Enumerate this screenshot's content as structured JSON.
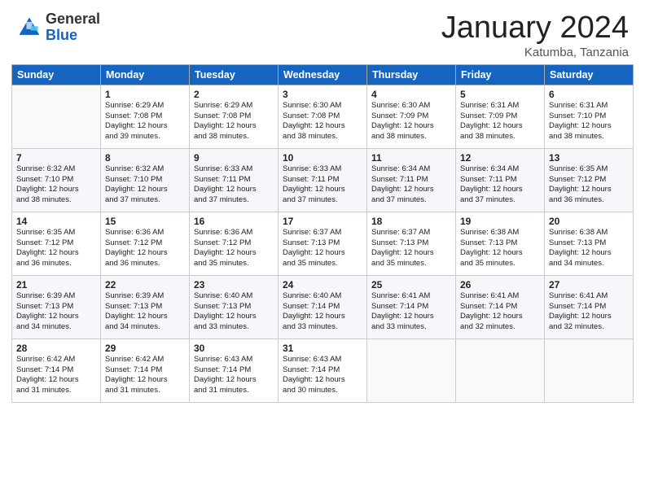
{
  "logo": {
    "general": "General",
    "blue": "Blue"
  },
  "header": {
    "month": "January 2024",
    "location": "Katumba, Tanzania"
  },
  "days_of_week": [
    "Sunday",
    "Monday",
    "Tuesday",
    "Wednesday",
    "Thursday",
    "Friday",
    "Saturday"
  ],
  "weeks": [
    [
      {
        "day": "",
        "info": ""
      },
      {
        "day": "1",
        "info": "Sunrise: 6:29 AM\nSunset: 7:08 PM\nDaylight: 12 hours\nand 39 minutes."
      },
      {
        "day": "2",
        "info": "Sunrise: 6:29 AM\nSunset: 7:08 PM\nDaylight: 12 hours\nand 38 minutes."
      },
      {
        "day": "3",
        "info": "Sunrise: 6:30 AM\nSunset: 7:08 PM\nDaylight: 12 hours\nand 38 minutes."
      },
      {
        "day": "4",
        "info": "Sunrise: 6:30 AM\nSunset: 7:09 PM\nDaylight: 12 hours\nand 38 minutes."
      },
      {
        "day": "5",
        "info": "Sunrise: 6:31 AM\nSunset: 7:09 PM\nDaylight: 12 hours\nand 38 minutes."
      },
      {
        "day": "6",
        "info": "Sunrise: 6:31 AM\nSunset: 7:10 PM\nDaylight: 12 hours\nand 38 minutes."
      }
    ],
    [
      {
        "day": "7",
        "info": "Sunrise: 6:32 AM\nSunset: 7:10 PM\nDaylight: 12 hours\nand 38 minutes."
      },
      {
        "day": "8",
        "info": "Sunrise: 6:32 AM\nSunset: 7:10 PM\nDaylight: 12 hours\nand 37 minutes."
      },
      {
        "day": "9",
        "info": "Sunrise: 6:33 AM\nSunset: 7:11 PM\nDaylight: 12 hours\nand 37 minutes."
      },
      {
        "day": "10",
        "info": "Sunrise: 6:33 AM\nSunset: 7:11 PM\nDaylight: 12 hours\nand 37 minutes."
      },
      {
        "day": "11",
        "info": "Sunrise: 6:34 AM\nSunset: 7:11 PM\nDaylight: 12 hours\nand 37 minutes."
      },
      {
        "day": "12",
        "info": "Sunrise: 6:34 AM\nSunset: 7:11 PM\nDaylight: 12 hours\nand 37 minutes."
      },
      {
        "day": "13",
        "info": "Sunrise: 6:35 AM\nSunset: 7:12 PM\nDaylight: 12 hours\nand 36 minutes."
      }
    ],
    [
      {
        "day": "14",
        "info": "Sunrise: 6:35 AM\nSunset: 7:12 PM\nDaylight: 12 hours\nand 36 minutes."
      },
      {
        "day": "15",
        "info": "Sunrise: 6:36 AM\nSunset: 7:12 PM\nDaylight: 12 hours\nand 36 minutes."
      },
      {
        "day": "16",
        "info": "Sunrise: 6:36 AM\nSunset: 7:12 PM\nDaylight: 12 hours\nand 35 minutes."
      },
      {
        "day": "17",
        "info": "Sunrise: 6:37 AM\nSunset: 7:13 PM\nDaylight: 12 hours\nand 35 minutes."
      },
      {
        "day": "18",
        "info": "Sunrise: 6:37 AM\nSunset: 7:13 PM\nDaylight: 12 hours\nand 35 minutes."
      },
      {
        "day": "19",
        "info": "Sunrise: 6:38 AM\nSunset: 7:13 PM\nDaylight: 12 hours\nand 35 minutes."
      },
      {
        "day": "20",
        "info": "Sunrise: 6:38 AM\nSunset: 7:13 PM\nDaylight: 12 hours\nand 34 minutes."
      }
    ],
    [
      {
        "day": "21",
        "info": "Sunrise: 6:39 AM\nSunset: 7:13 PM\nDaylight: 12 hours\nand 34 minutes."
      },
      {
        "day": "22",
        "info": "Sunrise: 6:39 AM\nSunset: 7:13 PM\nDaylight: 12 hours\nand 34 minutes."
      },
      {
        "day": "23",
        "info": "Sunrise: 6:40 AM\nSunset: 7:13 PM\nDaylight: 12 hours\nand 33 minutes."
      },
      {
        "day": "24",
        "info": "Sunrise: 6:40 AM\nSunset: 7:14 PM\nDaylight: 12 hours\nand 33 minutes."
      },
      {
        "day": "25",
        "info": "Sunrise: 6:41 AM\nSunset: 7:14 PM\nDaylight: 12 hours\nand 33 minutes."
      },
      {
        "day": "26",
        "info": "Sunrise: 6:41 AM\nSunset: 7:14 PM\nDaylight: 12 hours\nand 32 minutes."
      },
      {
        "day": "27",
        "info": "Sunrise: 6:41 AM\nSunset: 7:14 PM\nDaylight: 12 hours\nand 32 minutes."
      }
    ],
    [
      {
        "day": "28",
        "info": "Sunrise: 6:42 AM\nSunset: 7:14 PM\nDaylight: 12 hours\nand 31 minutes."
      },
      {
        "day": "29",
        "info": "Sunrise: 6:42 AM\nSunset: 7:14 PM\nDaylight: 12 hours\nand 31 minutes."
      },
      {
        "day": "30",
        "info": "Sunrise: 6:43 AM\nSunset: 7:14 PM\nDaylight: 12 hours\nand 31 minutes."
      },
      {
        "day": "31",
        "info": "Sunrise: 6:43 AM\nSunset: 7:14 PM\nDaylight: 12 hours\nand 30 minutes."
      },
      {
        "day": "",
        "info": ""
      },
      {
        "day": "",
        "info": ""
      },
      {
        "day": "",
        "info": ""
      }
    ]
  ]
}
